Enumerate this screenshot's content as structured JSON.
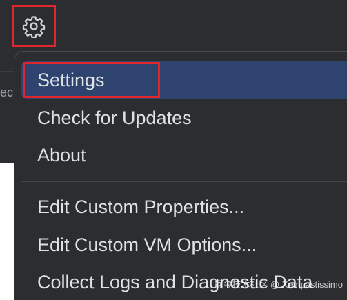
{
  "toolbar": {
    "settings_icon": "gear-icon",
    "peek_text": "ec"
  },
  "menu": {
    "items": [
      {
        "label": "Settings",
        "selected": true
      },
      {
        "label": "Check for Updates"
      },
      {
        "label": "About"
      },
      {
        "label": "Edit Custom Properties..."
      },
      {
        "label": "Edit Custom VM Options..."
      },
      {
        "label": "Collect Logs and Diagnostic Data"
      }
    ]
  },
  "watermark": "掘金技术社区 @ Xempastissimo",
  "colors": {
    "background_dark": "#2b2d30",
    "selection": "#2e436e",
    "highlight_border": "#e0262d",
    "text": "#dfe1e5"
  }
}
